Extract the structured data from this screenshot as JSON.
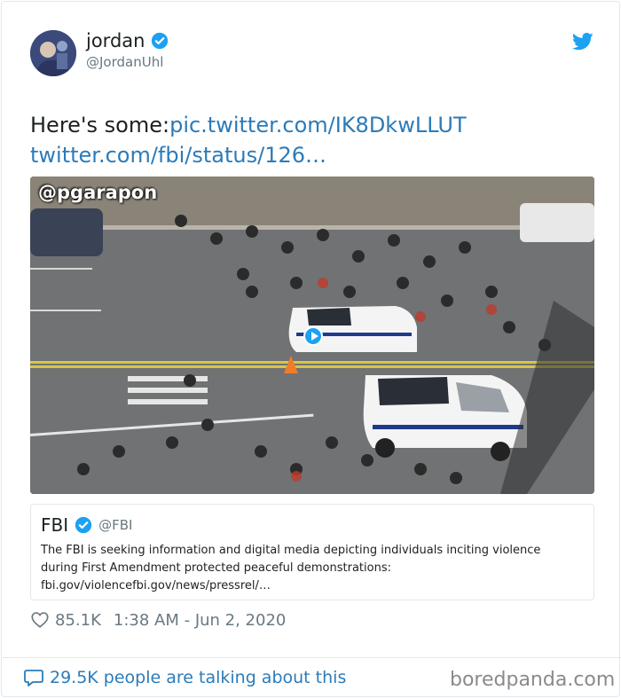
{
  "author": {
    "name": "jordan",
    "handle": "@JordanUhl"
  },
  "tweet": {
    "prefix": "Here's some:",
    "link1": "pic.twitter.com/IK8DkwLLUT",
    "link2": "twitter.com/fbi/status/126…"
  },
  "media": {
    "watermark": "@pgarapon"
  },
  "quoted": {
    "name": "FBI",
    "handle": "@FBI",
    "line1": "The FBI is seeking information and digital media depicting individuals inciting violence",
    "line2": "during First Amendment protected peaceful demonstrations:",
    "line3": "fbi.gov/violencefbi.gov/news/pressrel/…"
  },
  "stats": {
    "likes": "85.1K",
    "timestamp": "1:38 AM - Jun 2, 2020"
  },
  "footer": {
    "talking": "29.5K people are talking about this",
    "brand": "boredpanda.com"
  },
  "icons": {
    "verified": "verified-badge-icon",
    "bird": "twitter-bird-icon",
    "heart": "heart-icon",
    "bubble": "speech-bubble-icon"
  },
  "colors": {
    "link": "#2b7bb9",
    "verified": "#1da1f2",
    "muted": "#697882"
  }
}
